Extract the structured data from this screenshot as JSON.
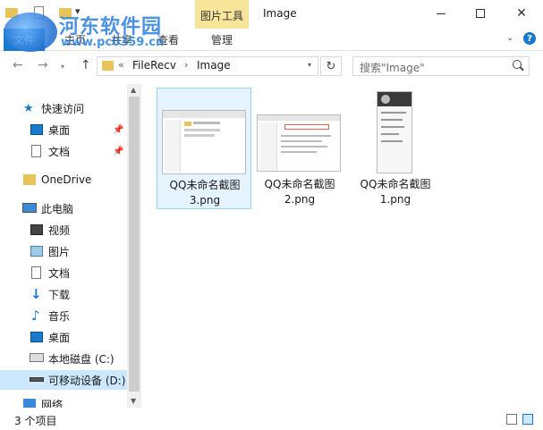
{
  "window": {
    "title": "Image",
    "context_tab": "图片工具",
    "minimize": "—",
    "close": "✕"
  },
  "watermark": {
    "title": "河东软件园",
    "url": "www.pc0359.cn"
  },
  "ribbon": {
    "file": "文件",
    "tabs": [
      "主页",
      "共享",
      "查看",
      "管理"
    ],
    "help": "?"
  },
  "address": {
    "path": [
      "FileRecv",
      "Image"
    ],
    "prefix": "«",
    "separator": "›"
  },
  "search": {
    "placeholder": "搜索\"Image\""
  },
  "nav": {
    "quick_access": "快速访问",
    "desktop": "桌面",
    "documents": "文档",
    "onedrive": "OneDrive",
    "this_pc": "此电脑",
    "videos": "视频",
    "pictures": "图片",
    "documents2": "文档",
    "downloads": "下载",
    "music": "音乐",
    "desktop2": "桌面",
    "local_disk": "本地磁盘 (C:)",
    "removable": "可移动设备 (D:)",
    "network": "网络"
  },
  "files": [
    {
      "name": "QQ未命名截图3.png"
    },
    {
      "name": "QQ未命名截图2.png"
    },
    {
      "name": "QQ未命名截图1.png"
    }
  ],
  "status": {
    "count": "3 个项目"
  },
  "colors": {
    "accent": "#1979ca",
    "selection": "#cce8ff",
    "tools_tab": "#f7e59a",
    "folder": "#e8c35a"
  }
}
